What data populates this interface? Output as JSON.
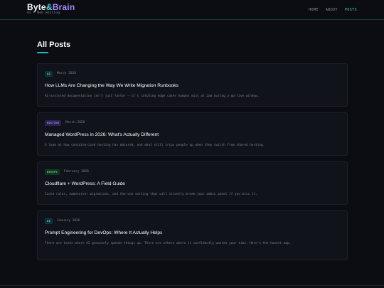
{
  "header": {
    "logo": {
      "word1": "Byte",
      "amp": "&",
      "word2": "Brain"
    },
    "tagline": "AI • Web Hosting",
    "nav": [
      {
        "label": "HOME",
        "active": false
      },
      {
        "label": "ABOUT",
        "active": false
      },
      {
        "label": "POSTS",
        "active": true
      }
    ]
  },
  "page": {
    "title": "All Posts"
  },
  "posts": [
    {
      "tag": "AI",
      "tag_colors": {
        "bg": "#113237",
        "fg": "#4fd1d9"
      },
      "date": "March 2026",
      "title": "How LLMs Are Changing the Way We Write Migration Runbooks",
      "excerpt": "AI-assisted documentation isn't just faster — it's catching edge cases humans miss at 2am during a go-live window."
    },
    {
      "tag": "HOSTING",
      "tag_colors": {
        "bg": "#2a2350",
        "fg": "#a78bfa"
      },
      "date": "March 2026",
      "title": "Managed WordPress in 2026: What's Actually Different",
      "excerpt": "A look at how containerized hosting has matured, and what still trips people up when they switch from shared hosting."
    },
    {
      "tag": "DEVOPS",
      "tag_colors": {
        "bg": "#133324",
        "fg": "#4ade80"
      },
      "date": "February 2026",
      "title": "Cloudflare + WordPress: A Field Guide",
      "excerpt": "Cache rules, nameserver migrations, and the one setting that will silently break your admin panel if you miss it."
    },
    {
      "tag": "AI",
      "tag_colors": {
        "bg": "#113237",
        "fg": "#4fd1d9"
      },
      "date": "January 2026",
      "title": "Prompt Engineering for DevOps: Where It Actually Helps",
      "excerpt": "There are tasks where AI genuinely speeds things up. There are others where it confidently wastes your time. Here's the honest map."
    }
  ]
}
